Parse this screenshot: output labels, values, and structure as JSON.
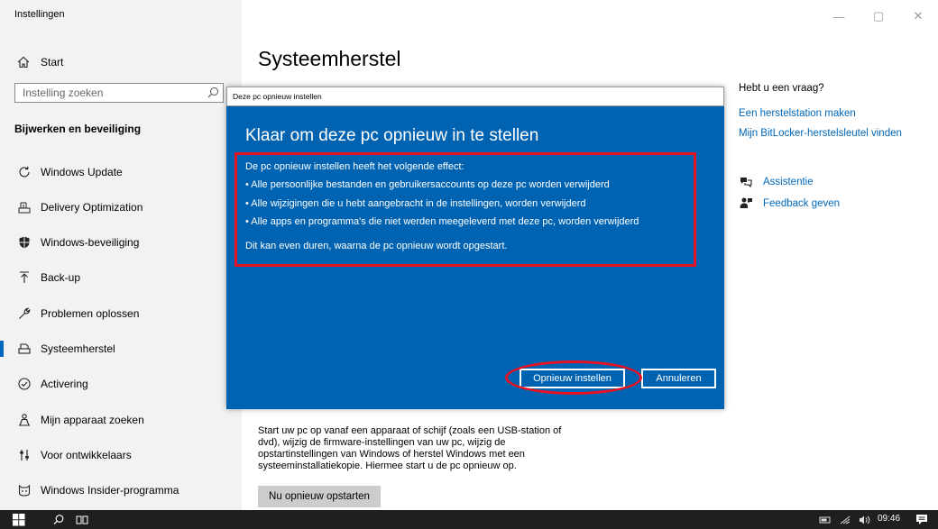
{
  "window": {
    "app_title": "Instellingen",
    "controls": {
      "minimize": "—",
      "maximize": "▢",
      "close": "✕"
    }
  },
  "sidebar": {
    "home_label": "Start",
    "search_placeholder": "Instelling zoeken",
    "section_title": "Bijwerken en beveiliging",
    "items": [
      {
        "label": "Windows Update",
        "icon": "refresh-icon"
      },
      {
        "label": "Delivery Optimization",
        "icon": "delivery-optimization-icon"
      },
      {
        "label": "Windows-beveiliging",
        "icon": "shield-icon"
      },
      {
        "label": "Back-up",
        "icon": "backup-arrow-icon"
      },
      {
        "label": "Problemen oplossen",
        "icon": "wrench-icon"
      },
      {
        "label": "Systeemherstel",
        "icon": "recovery-icon",
        "active": true
      },
      {
        "label": "Activering",
        "icon": "checkmark-circle-icon"
      },
      {
        "label": "Mijn apparaat zoeken",
        "icon": "person-location-icon"
      },
      {
        "label": "Voor ontwikkelaars",
        "icon": "developer-sliders-icon"
      },
      {
        "label": "Windows Insider-programma",
        "icon": "insider-cat-icon"
      }
    ]
  },
  "main": {
    "title": "Systeemherstel",
    "description": "Start uw pc op vanaf een apparaat of schijf (zoals een USB-station of dvd), wijzig de firmware-instellingen van uw pc, wijzig de opstartinstellingen van Windows of herstel Windows met een systeeminstallatiekopie. Hiermee start u de pc opnieuw op.",
    "restart_button": "Nu opnieuw opstarten"
  },
  "help": {
    "heading": "Hebt u een vraag?",
    "links": [
      "Een herstelstation maken",
      "Mijn BitLocker-herstelsleutel vinden"
    ],
    "assist_label": "Assistentie",
    "feedback_label": "Feedback geven"
  },
  "dialog": {
    "window_title": "Deze pc opnieuw instellen",
    "heading": "Klaar om deze pc opnieuw in te stellen",
    "intro": "De pc opnieuw instellen heeft het volgende effect:",
    "bullets": [
      "• Alle persoonlijke bestanden en gebruikersaccounts op deze pc worden verwijderd",
      "• Alle wijzigingen die u hebt aangebracht in de instellingen, worden verwijderd",
      "• Alle apps en programma's die niet werden meegeleverd met deze pc, worden verwijderd"
    ],
    "note": "Dit kan even duren, waarna de pc opnieuw wordt opgestart.",
    "primary_button": "Opnieuw instellen",
    "secondary_button": "Annuleren",
    "background_color": "#0063b1",
    "highlight_color": "#e81123"
  },
  "taskbar": {
    "clock": "09:46",
    "start_icon": "windows-logo-icon",
    "search_icon": "search-icon",
    "task_view_icon": "task-view-icon"
  }
}
